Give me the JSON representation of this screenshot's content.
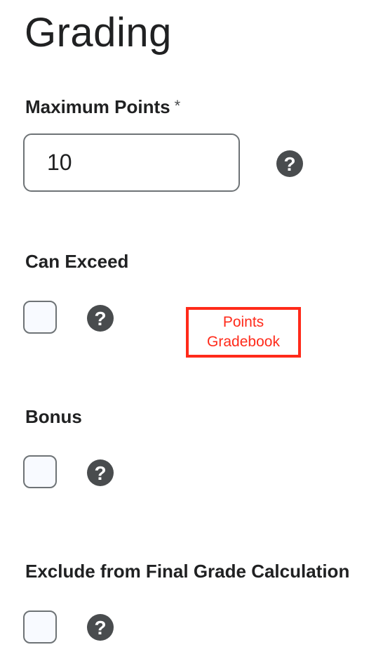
{
  "page": {
    "title": "Grading"
  },
  "maximum_points": {
    "label": "Maximum Points",
    "required_marker": "*",
    "value": "10",
    "help_icon": "question-circle-icon"
  },
  "can_exceed": {
    "label": "Can Exceed",
    "checked": false,
    "help_icon": "question-circle-icon"
  },
  "annotation": {
    "line1": "Points",
    "line2": "Gradebook",
    "color": "#ff2a1a"
  },
  "bonus": {
    "label": "Bonus",
    "checked": false,
    "help_icon": "question-circle-icon"
  },
  "exclude_final_grade": {
    "label": "Exclude from Final Grade Calculation",
    "checked": false,
    "help_icon": "question-circle-icon"
  },
  "help_glyph": "?",
  "colors": {
    "text": "#202122",
    "border": "#6e7376",
    "checkbox_fill": "#f8faff",
    "help_icon": "#494c4e",
    "annotation": "#ff2a1a"
  }
}
